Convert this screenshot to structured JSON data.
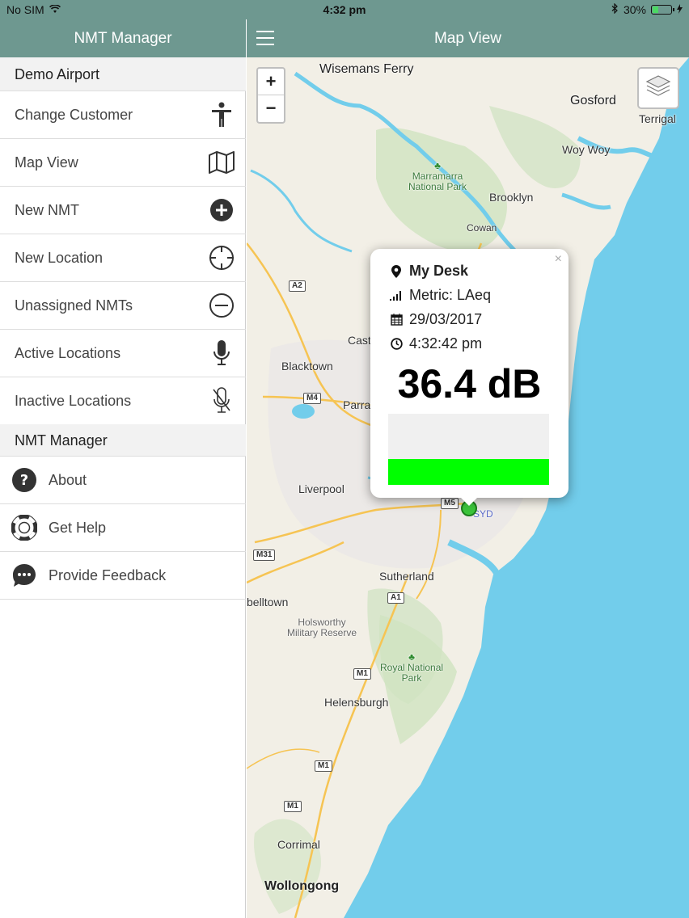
{
  "status_bar": {
    "carrier": "No SIM",
    "time": "4:32 pm",
    "battery": "30%",
    "battery_level": 0.3
  },
  "sidebar": {
    "title": "NMT Manager",
    "section1": "Demo Airport",
    "items": [
      {
        "label": "Change Customer",
        "icon": "person-icon"
      },
      {
        "label": "Map View",
        "icon": "map-icon"
      },
      {
        "label": "New NMT",
        "icon": "plus-circle-icon"
      },
      {
        "label": "New Location",
        "icon": "crosshair-icon"
      },
      {
        "label": "Unassigned NMTs",
        "icon": "minus-circle-icon"
      },
      {
        "label": "Active Locations",
        "icon": "microphone-icon"
      },
      {
        "label": "Inactive Locations",
        "icon": "microphone-slash-icon"
      }
    ],
    "section2": "NMT Manager",
    "items2": [
      {
        "label": "About",
        "icon": "question-circle-icon"
      },
      {
        "label": "Get Help",
        "icon": "lifebuoy-icon"
      },
      {
        "label": "Provide Feedback",
        "icon": "chat-bubble-icon"
      }
    ]
  },
  "map_header": {
    "title": "Map View"
  },
  "map": {
    "zoom_in": "+",
    "zoom_out": "−",
    "places": {
      "wisemans_ferry": "Wisemans Ferry",
      "gosford": "Gosford",
      "terrigal": "Terrigal",
      "woy_woy": "Woy Woy",
      "marramarra_1": "Marramarra",
      "marramarra_2": "National Park",
      "brooklyn": "Brooklyn",
      "cowan": "Cowan",
      "castle": "Cast",
      "blacktown": "Blacktown",
      "parra": "Parra",
      "liverpool": "Liverpool",
      "syd": "SYD",
      "sutherland": "Sutherland",
      "belltown": "belltown",
      "holsworthy_1": "Holsworthy",
      "holsworthy_2": "Military Reserve",
      "royal_1": "Royal National",
      "royal_2": "Park",
      "helensburgh": "Helensburgh",
      "corrimal": "Corrimal",
      "wollongong": "Wollongong"
    },
    "shields": {
      "a2": "A2",
      "m4": "M4",
      "m5": "M5",
      "m31": "M31",
      "a1": "A1",
      "m1a": "M1",
      "m1b": "M1",
      "m1c": "M1"
    }
  },
  "popup": {
    "location": "My Desk",
    "metric": "Metric: LAeq",
    "date": "29/03/2017",
    "time": "4:32:42 pm",
    "value": "36.4 dB",
    "level_fraction": 0.36,
    "level_color": "#00ff00",
    "close": "×"
  },
  "colors": {
    "header": "#6e9890",
    "water": "#72cdeb",
    "land": "#f2efe6",
    "park": "#cfe3c1"
  }
}
